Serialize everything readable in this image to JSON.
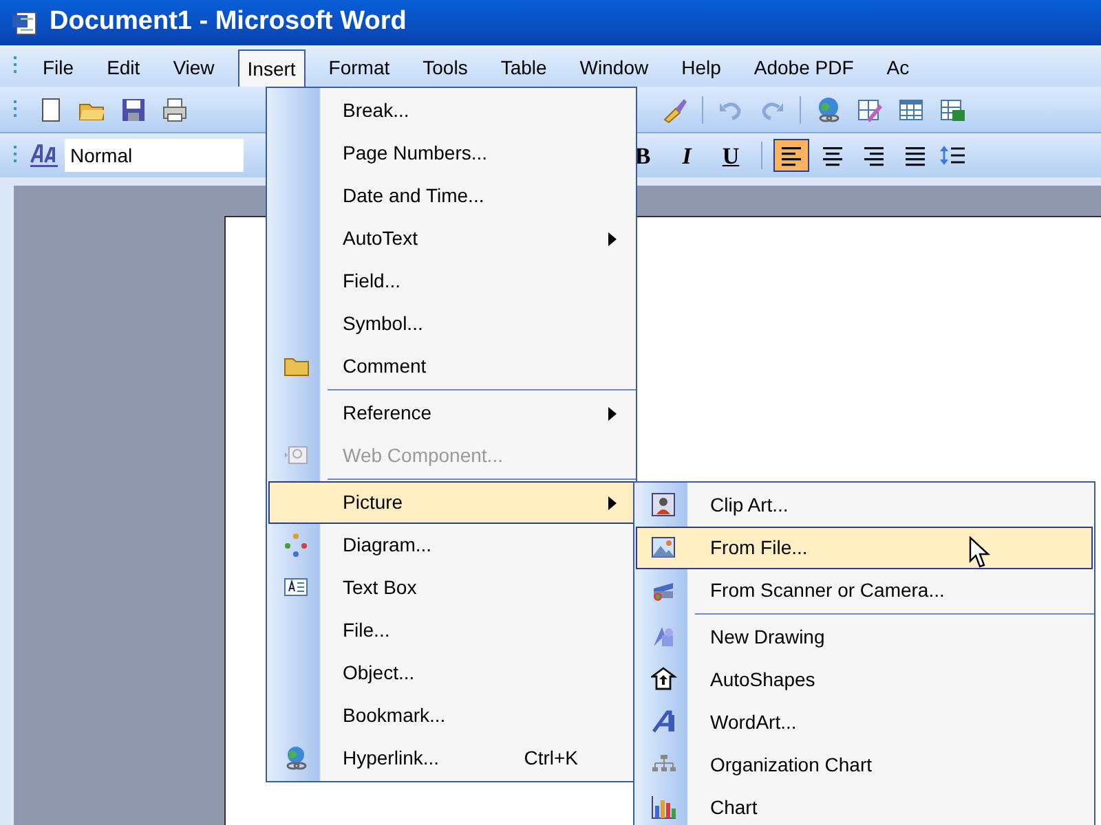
{
  "window": {
    "title": "Document1 - Microsoft Word"
  },
  "menu_bar": [
    {
      "label": "File",
      "selected": false
    },
    {
      "label": "Edit",
      "selected": false
    },
    {
      "label": "View",
      "selected": false
    },
    {
      "label": "Insert",
      "selected": true
    },
    {
      "label": "Format",
      "selected": false
    },
    {
      "label": "Tools",
      "selected": false
    },
    {
      "label": "Table",
      "selected": false
    },
    {
      "label": "Window",
      "selected": false
    },
    {
      "label": "Help",
      "selected": false
    },
    {
      "label": "Adobe PDF",
      "selected": false
    },
    {
      "label": "Ac",
      "selected": false
    }
  ],
  "formatting_toolbar": {
    "style": "Normal",
    "text_buttons": [
      {
        "label": "B",
        "kind": "bold"
      },
      {
        "label": "I",
        "kind": "italic"
      },
      {
        "label": "U",
        "kind": "underline"
      }
    ],
    "alignment": [
      {
        "kind": "left",
        "selected": true
      },
      {
        "kind": "center",
        "selected": false
      },
      {
        "kind": "right",
        "selected": false
      },
      {
        "kind": "justify",
        "selected": false
      }
    ]
  },
  "insert_menu": {
    "items": [
      {
        "kind": "item",
        "label": "Break...",
        "submenu": false,
        "disabled": false,
        "selected": false
      },
      {
        "kind": "item",
        "label": "Page Numbers...",
        "submenu": false,
        "disabled": false,
        "selected": false
      },
      {
        "kind": "item",
        "label": "Date and Time...",
        "submenu": false,
        "disabled": false,
        "selected": false
      },
      {
        "kind": "item",
        "label": "AutoText",
        "submenu": true,
        "disabled": false,
        "selected": false
      },
      {
        "kind": "item",
        "label": "Field...",
        "submenu": false,
        "disabled": false,
        "selected": false
      },
      {
        "kind": "item",
        "label": "Symbol...",
        "submenu": false,
        "disabled": false,
        "selected": false
      },
      {
        "kind": "item",
        "label": "Comment",
        "submenu": false,
        "disabled": false,
        "selected": false
      },
      {
        "kind": "separator"
      },
      {
        "kind": "item",
        "label": "Reference",
        "submenu": true,
        "disabled": false,
        "selected": false
      },
      {
        "kind": "item",
        "label": "Web Component...",
        "submenu": false,
        "disabled": true,
        "selected": false
      },
      {
        "kind": "separator"
      },
      {
        "kind": "item",
        "label": "Picture",
        "submenu": true,
        "disabled": false,
        "selected": true
      },
      {
        "kind": "item",
        "label": "Diagram...",
        "submenu": false,
        "disabled": false,
        "selected": false
      },
      {
        "kind": "item",
        "label": "Text Box",
        "submenu": false,
        "disabled": false,
        "selected": false
      },
      {
        "kind": "item",
        "label": "File...",
        "submenu": false,
        "disabled": false,
        "selected": false
      },
      {
        "kind": "item",
        "label": "Object...",
        "submenu": false,
        "disabled": false,
        "selected": false
      },
      {
        "kind": "item",
        "label": "Bookmark...",
        "submenu": false,
        "disabled": false,
        "selected": false
      },
      {
        "kind": "item",
        "label": "Hyperlink...",
        "shortcut": "Ctrl+K",
        "submenu": false,
        "disabled": false,
        "selected": false
      }
    ]
  },
  "picture_submenu": {
    "items": [
      {
        "kind": "item",
        "label": "Clip Art...",
        "selected": false
      },
      {
        "kind": "item",
        "label": "From File...",
        "selected": true
      },
      {
        "kind": "item",
        "label": "From Scanner or Camera...",
        "selected": false
      },
      {
        "kind": "separator"
      },
      {
        "kind": "item",
        "label": "New Drawing",
        "selected": false
      },
      {
        "kind": "item",
        "label": "AutoShapes",
        "selected": false
      },
      {
        "kind": "item",
        "label": "WordArt...",
        "selected": false
      },
      {
        "kind": "item",
        "label": "Organization Chart",
        "selected": false
      },
      {
        "kind": "item",
        "label": "Chart",
        "selected": false
      }
    ]
  }
}
